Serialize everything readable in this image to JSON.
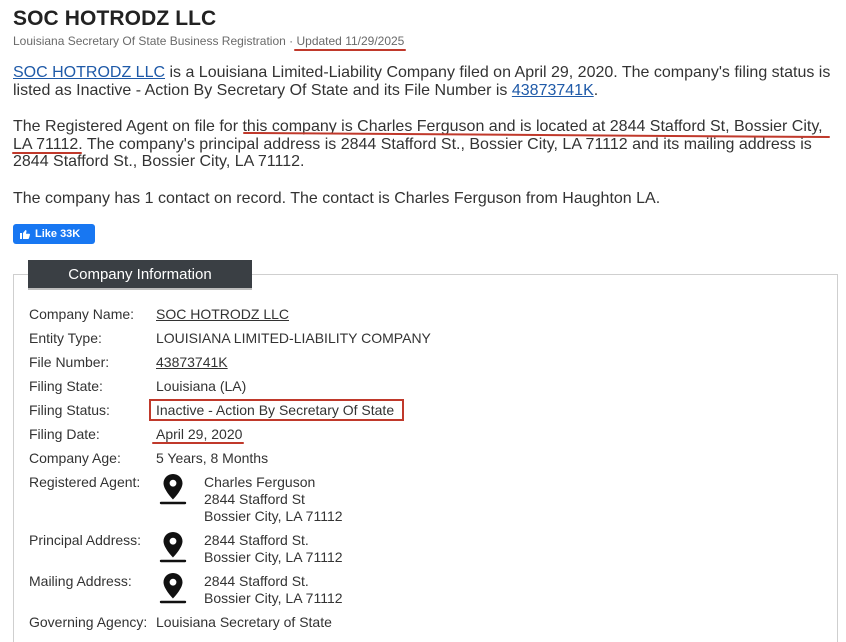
{
  "header": {
    "title": "SOC HOTRODZ LLC",
    "subtitle_prefix": "Louisiana Secretary Of State Business Registration · ",
    "updated": "Updated 11/29/2025"
  },
  "intro": {
    "p1_link": "SOC HOTRODZ LLC",
    "p1_text": " is a Louisiana Limited-Liability Company filed on April 29, 2020. The company's filing status is listed as Inactive - Action By Secretary Of State and its File Number is ",
    "p1_file_link": "43873741K",
    "p1_end": ".",
    "p2_a": "The Registered Agent on file for ",
    "p2_b": "this company is Charles Ferguson and is located at 2844 Stafford St, Bossier City,",
    "p2_c": "LA 71112",
    "p2_d": ". The company's principal address is 2844 Stafford St., Bossier City, LA 71112 and its mailing address is 2844 Stafford St., Bossier City, LA 71112.",
    "p3": "The company has 1 contact on record. The contact is Charles Ferguson from Haughton LA."
  },
  "facebook": {
    "like_label": "Like 33K"
  },
  "panel": {
    "tab_label": "Company Information",
    "rows": {
      "company_name": {
        "label": "Company Name:",
        "value": "SOC HOTRODZ LLC"
      },
      "entity_type": {
        "label": "Entity Type:",
        "value": "LOUISIANA LIMITED-LIABILITY COMPANY"
      },
      "file_number": {
        "label": "File Number:",
        "value": "43873741K"
      },
      "filing_state": {
        "label": "Filing State:",
        "value": "Louisiana (LA)"
      },
      "filing_status": {
        "label": "Filing Status:",
        "value": "Inactive - Action By Secretary Of State"
      },
      "filing_date": {
        "label": "Filing Date:",
        "value": "April 29, 2020"
      },
      "company_age": {
        "label": "Company Age:",
        "value": "5 Years, 8 Months"
      },
      "registered_agent": {
        "label": "Registered Agent:",
        "line1": "Charles Ferguson",
        "line2": "2844 Stafford St",
        "line3": "Bossier City, LA 71112"
      },
      "principal_address": {
        "label": "Principal Address:",
        "line1": "2844 Stafford St.",
        "line2": "Bossier City, LA 71112"
      },
      "mailing_address": {
        "label": "Mailing Address:",
        "line1": "2844 Stafford St.",
        "line2": "Bossier City, LA 71112"
      },
      "governing_agency": {
        "label": "Governing Agency:",
        "value": "Louisiana Secretary of State"
      }
    }
  },
  "icons": {
    "pin": "map-pin-icon",
    "thumb": "thumbs-up-icon"
  },
  "colors": {
    "accent_red": "#c0392b",
    "link": "#1f5aa8",
    "tab_bg": "#3a3f44",
    "fb_blue": "#1877f2"
  }
}
